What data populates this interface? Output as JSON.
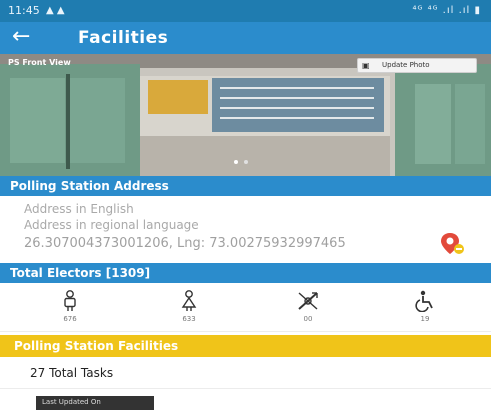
{
  "status_bar": {
    "time": "11:45",
    "icons_text": "▲ ▲",
    "right_text": "⁴ᴳ ⁴ᴳ .ıl .ıl ▮"
  },
  "app_bar": {
    "title": "Facilities",
    "back_icon": "←"
  },
  "photo": {
    "label": "PS Front View",
    "update_button": "Update Photo"
  },
  "address_section": {
    "title": "Polling Station Address",
    "address_english": "Address in English",
    "address_regional": "Address in regional language",
    "coordinates": "26.307004373001206, Lng: 73.00275932997465"
  },
  "electors_section": {
    "title": "Total Electors [1309]",
    "stats": [
      {
        "icon": "male-icon",
        "value": "676"
      },
      {
        "icon": "female-icon",
        "value": "633"
      },
      {
        "icon": "third-gender-icon",
        "value": "00"
      },
      {
        "icon": "wheelchair-icon",
        "value": "19"
      }
    ]
  },
  "facilities_section": {
    "title": "Polling Station Facilities",
    "total_tasks": "27 Total Tasks",
    "last_updated": "Last Updated On"
  },
  "colors": {
    "primary": "#2b8ccc",
    "status": "#1f7cb0",
    "accent": "#f0c419"
  }
}
